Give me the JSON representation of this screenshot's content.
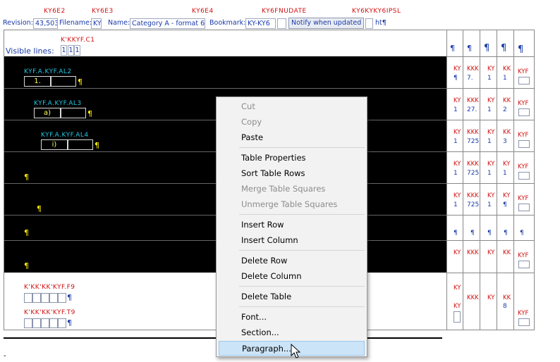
{
  "header": {
    "codes": [
      "KY6E2",
      "KY6E3",
      "KY6E4",
      "KY6FNUDATE",
      "KY6KYKY6IPSL"
    ],
    "revision_label": "Revision:",
    "revision_value": "43,503",
    "filename_label": "Filename:",
    "filename_value": "KY",
    "name_label": "Name:",
    "name_value": "Category A - format 6",
    "bookmark_label": "Bookmark:",
    "bookmark_value": "KY-KY6",
    "notify_button": "Notify when updated",
    "trailing_text": "ht¶"
  },
  "table": {
    "top_code": "K'KKYF.C1",
    "visible_lines_label": "Visible lines:",
    "visible_lines_values": [
      "1",
      "1",
      "1"
    ],
    "pilcrow": "¶",
    "rows": [
      {
        "code": "KYF.A.KYF.AL2",
        "value": "1."
      },
      {
        "code": "KYF.A.KYF.AL3",
        "value": "a)"
      },
      {
        "code": "KYF.A.KYF.AL4",
        "value": "i)"
      }
    ],
    "bottom_code_1": "K'KK'KK'KYF.F9",
    "bottom_code_2": "K'KK'KK'KYF.T9",
    "side_codes": {
      "ky": "KY",
      "kkk": "KKK",
      "kk": "KK",
      "kyf": "KYF",
      "v1": "7.",
      "v2": "27.",
      "v3": "725",
      "v4": "1",
      "v5": "2",
      "v6": "3",
      "v7": "8"
    }
  },
  "context_menu": {
    "items": [
      {
        "label": "Cut",
        "disabled": true
      },
      {
        "label": "Copy",
        "disabled": true
      },
      {
        "label": "Paste",
        "disabled": false
      },
      {
        "label": "Table Properties",
        "disabled": false
      },
      {
        "label": "Sort Table Rows",
        "disabled": false
      },
      {
        "label": "Merge Table Squares",
        "disabled": true
      },
      {
        "label": "Unmerge Table Squares",
        "disabled": true
      },
      {
        "label": "Insert Row",
        "disabled": false
      },
      {
        "label": "Insert Column",
        "disabled": false
      },
      {
        "label": "Delete Row",
        "disabled": false
      },
      {
        "label": "Delete Column",
        "disabled": false
      },
      {
        "label": "Delete Table",
        "disabled": false
      },
      {
        "label": "Font...",
        "disabled": false
      },
      {
        "label": "Section...",
        "disabled": false
      },
      {
        "label": "Paragraph...",
        "disabled": false,
        "selected": true
      }
    ]
  },
  "footer_mark": "-",
  "colors": {
    "code_red": "#d01010",
    "code_cyan": "#22c5e0",
    "label_blue": "#1a3aa8",
    "pilcrow_yellow": "#ffee00",
    "menu_selected": "#cce4f7"
  }
}
